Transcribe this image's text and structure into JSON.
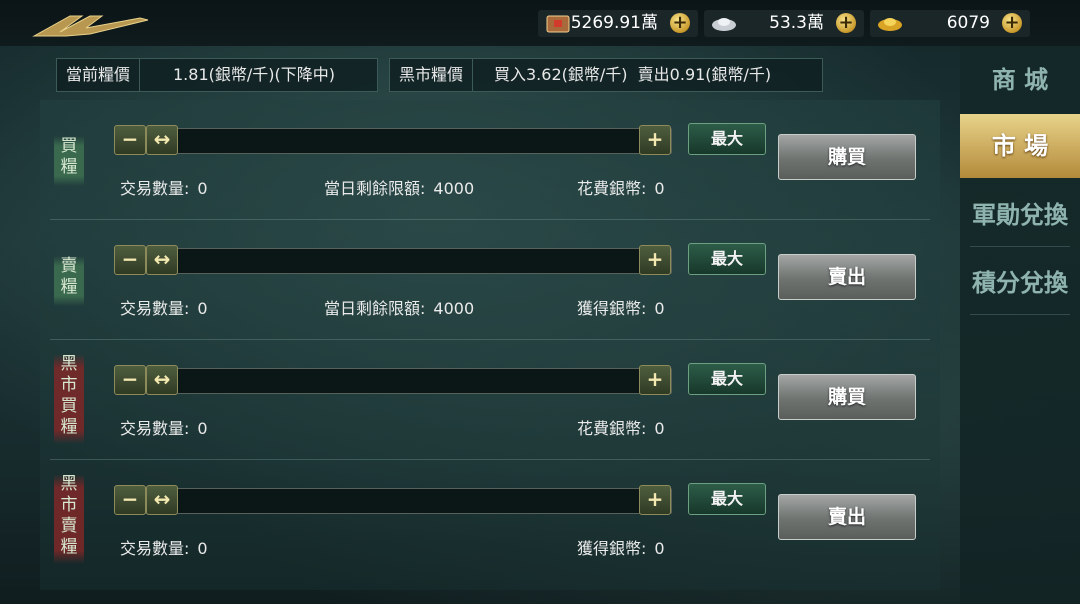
{
  "resources": [
    {
      "icon": "treasure-chest-icon",
      "value": "5269.91萬"
    },
    {
      "icon": "silver-ingot-icon",
      "value": "53.3萬"
    },
    {
      "icon": "gold-ingot-icon",
      "value": "6079"
    }
  ],
  "info": {
    "current_price_label": "當前糧價",
    "current_price_value": "1.81(銀幣/千)(下降中)",
    "black_market_label": "黑市糧價",
    "black_market_value": "買入3.62(銀幣/千)  賣出0.91(銀幣/千)"
  },
  "rows": [
    {
      "tag": "買糧",
      "tag_color": "#3c6e50",
      "max_label": "最大",
      "action_label": "購買",
      "qty_label": "交易數量:",
      "qty_value": "0",
      "limit_label": "當日剩餘限額:",
      "limit_value": "4000",
      "coin_label": "花費銀幣:",
      "coin_value": "0",
      "slider_fraction": 0
    },
    {
      "tag": "賣糧",
      "tag_color": "#3c6e50",
      "max_label": "最大",
      "action_label": "賣出",
      "qty_label": "交易數量:",
      "qty_value": "0",
      "limit_label": "當日剩餘限額:",
      "limit_value": "4000",
      "coin_label": "獲得銀幣:",
      "coin_value": "0",
      "slider_fraction": 0
    },
    {
      "tag": "黑市買糧",
      "tag_color": "#782828",
      "max_label": "最大",
      "action_label": "購買",
      "qty_label": "交易數量:",
      "qty_value": "0",
      "coin_label": "花費銀幣:",
      "coin_value": "0",
      "slider_fraction": 0
    },
    {
      "tag": "黑市賣糧",
      "tag_color": "#782828",
      "max_label": "最大",
      "action_label": "賣出",
      "qty_label": "交易數量:",
      "qty_value": "0",
      "coin_label": "獲得銀幣:",
      "coin_value": "0",
      "slider_fraction": 0
    }
  ],
  "nav": [
    {
      "label": "商 城",
      "active": false
    },
    {
      "label": "市 場",
      "active": true
    },
    {
      "label": "軍勛兌換",
      "active": false
    },
    {
      "label": "積分兌換",
      "active": false
    }
  ],
  "colors": {
    "accent_gold": "#d4b060",
    "button_green": "#2d5c48"
  }
}
